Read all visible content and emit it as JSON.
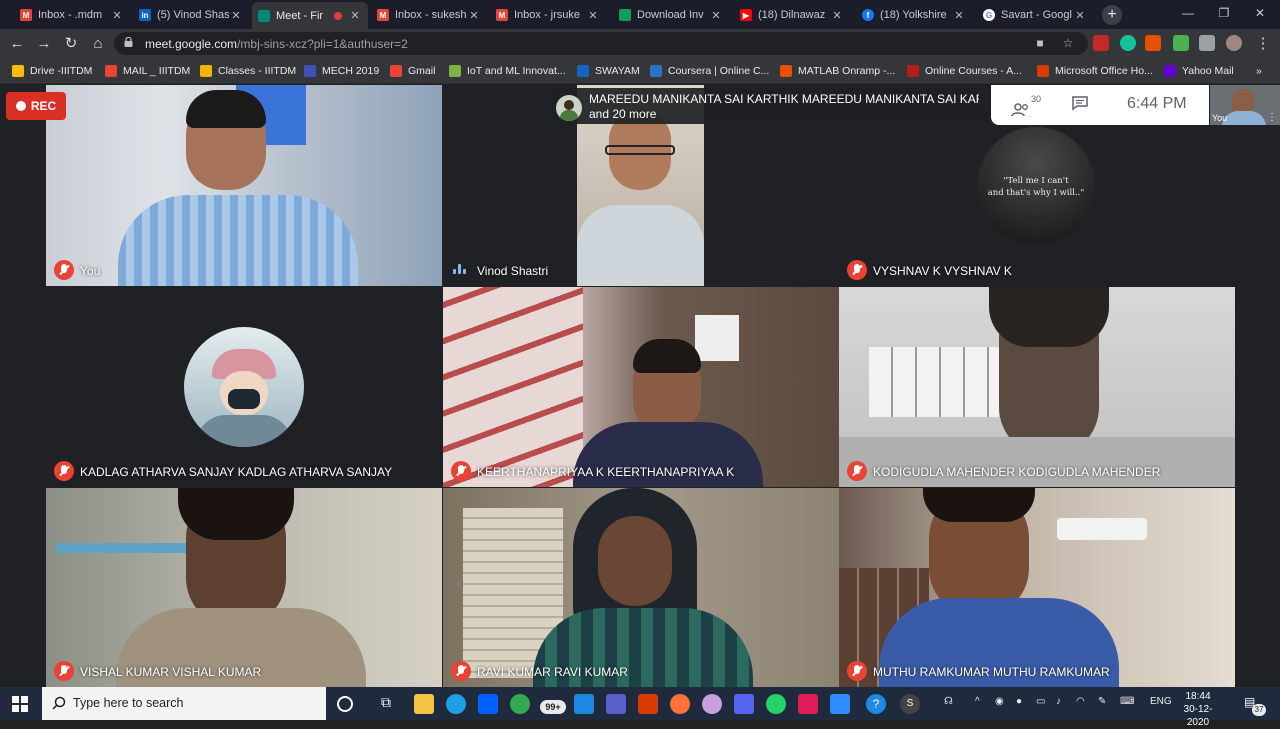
{
  "browser": {
    "tabs": [
      {
        "title": "Inbox - .mdm",
        "icon": "gmail-icon",
        "color": "#ea4335"
      },
      {
        "title": "(5) Vinod Shas",
        "icon": "linkedin-icon",
        "color": "#0a66c2"
      },
      {
        "title": "Meet - Fir",
        "icon": "meet-icon",
        "color": "#00897b",
        "active": true
      },
      {
        "title": "Inbox - sukesh",
        "icon": "gmail-icon",
        "color": "#ea4335"
      },
      {
        "title": "Inbox - jrsuke",
        "icon": "gmail-icon",
        "color": "#ea4335"
      },
      {
        "title": "Download Inv",
        "icon": "sheets-icon",
        "color": "#0f9d58"
      },
      {
        "title": "(18) Dilnawaz",
        "icon": "youtube-icon",
        "color": "#ff0000"
      },
      {
        "title": "(18) Yolkshire",
        "icon": "facebook-icon",
        "color": "#1877f2"
      },
      {
        "title": "Savart - Googl",
        "icon": "google-icon",
        "color": "#4285f4"
      }
    ],
    "url_host": "meet.google.com",
    "url_path": "/mbj-sins-xcz?pli=1&authuser=2",
    "bookmarks": [
      {
        "label": "Drive -IIITDM",
        "color": "#fbbc04"
      },
      {
        "label": "MAIL _ IIITDM",
        "color": "#ea4335"
      },
      {
        "label": "Classes - IIITDM",
        "color": "#f4b400"
      },
      {
        "label": "MECH 2019",
        "color": "#3f51b5"
      },
      {
        "label": "Gmail",
        "color": "#ea4335"
      },
      {
        "label": "IoT and ML Innovat...",
        "color": "#7cb342"
      },
      {
        "label": "SWAYAM",
        "color": "#1565c0"
      },
      {
        "label": "Coursera | Online C...",
        "color": "#2a73cc"
      },
      {
        "label": "MATLAB Onramp -...",
        "color": "#e65100"
      },
      {
        "label": "Online Courses - A...",
        "color": "#b71c1c"
      },
      {
        "label": "Microsoft Office Ho...",
        "color": "#d83b01"
      },
      {
        "label": "Yahoo Mail",
        "color": "#6001d2"
      }
    ]
  },
  "meet": {
    "rec_label": "REC",
    "presenter_line1": "MAREEDU MANIKANTA SAI KARTHIK MAREEDU MANIKANTA SAI KAR...",
    "presenter_line2": "and 20 more",
    "participant_count": "30",
    "time": "6:44 PM",
    "self_label": "You",
    "quote_line1": "\"Tell me I can't",
    "quote_line2": "and that's why I will..\"",
    "tiles": [
      {
        "name": "You"
      },
      {
        "name": "Vinod Shastri"
      },
      {
        "name": "VYSHNAV K VYSHNAV K"
      },
      {
        "name": "KADLAG ATHARVA SANJAY KADLAG ATHARVA SANJAY"
      },
      {
        "name": "KEERTHANAPRIYAA K KEERTHANAPRIYAA K"
      },
      {
        "name": "KODIGUDLA MAHENDER KODIGUDLA MAHENDER"
      },
      {
        "name": "VISHAL KUMAR VISHAL KUMAR"
      },
      {
        "name": "RAVI KUMAR RAVI KUMAR"
      },
      {
        "name": "MUTHU RAMKUMAR MUTHU RAMKUMAR"
      }
    ]
  },
  "taskbar": {
    "search_placeholder": "Type here to search",
    "badge": "99+",
    "lang": "ENG",
    "clock_time": "18:44",
    "clock_date": "30-12-2020",
    "notif_count": "37"
  }
}
